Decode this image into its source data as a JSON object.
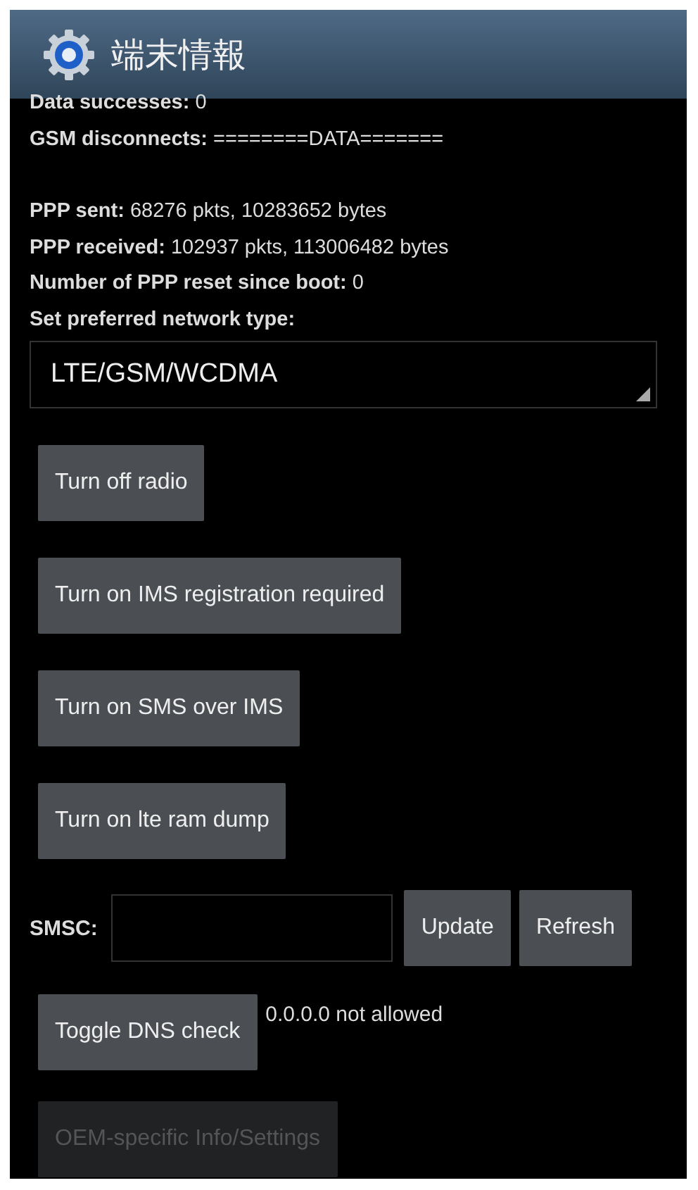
{
  "window": {
    "title": "端末情報"
  },
  "info_lines": [
    "**Data successes:** 0",
    "**GSM disconnects:** ========DATA=======",
    "**PPP sent:** 68276 pkts, 10283652 bytes",
    "**PPP received:** 102937 pkts, 113006482 bytes",
    "**Number of PPP reset since boot:** 0",
    "**Set preferred network type:**"
  ],
  "network_type": {
    "value": "LTE/GSM/WCDMA"
  },
  "buttons": [
    {
      "label": "Turn off radio",
      "disabled": false
    },
    {
      "label": "Turn on IMS registration required",
      "disabled": false
    },
    {
      "label": "Turn on SMS over IMS",
      "disabled": false
    },
    {
      "label": "Turn on lte ram dump",
      "disabled": false
    }
  ],
  "smsc": {
    "label": "SMSC:",
    "buttons": [
      {
        "label": "Update",
        "disabled": false
      },
      {
        "label": "Refresh",
        "disabled": false
      }
    ]
  },
  "dns": {
    "button": {
      "label": "Toggle DNS check",
      "disabled": false
    },
    "status": "0.0.0.0 not allowed"
  },
  "oem_button": {
    "label": "OEM-specific Info/Settings",
    "disabled": true
  }
}
